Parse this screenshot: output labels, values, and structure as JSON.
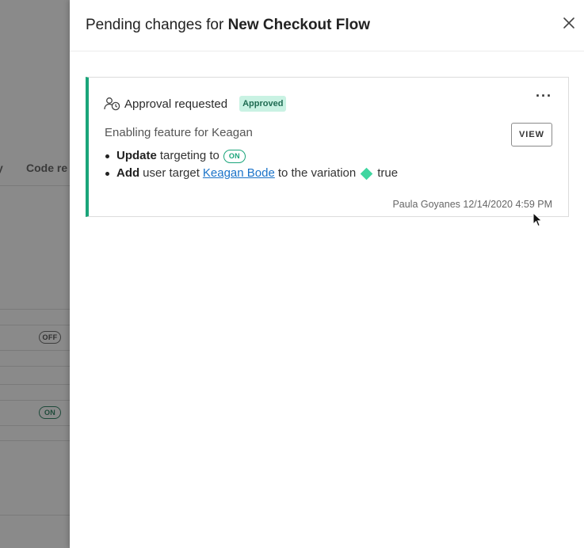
{
  "background": {
    "column_headers": [
      "y",
      "Code re"
    ],
    "row_toggles": [
      "OFF",
      "ON"
    ]
  },
  "panel": {
    "title_prefix": "Pending changes for",
    "title_flag": "New Checkout Flow"
  },
  "card": {
    "status_label": "Approval requested",
    "badge": "Approved",
    "more_label": "···",
    "view_button": "VIEW",
    "description": "Enabling feature for Keagan",
    "changes": [
      {
        "action": "Update",
        "text": "targeting to",
        "pill": "ON"
      },
      {
        "action": "Add",
        "text": "user target",
        "link": "Keagan Bode",
        "suffix": "to the variation",
        "variation": "true"
      }
    ],
    "author": "Paula Goyanes",
    "timestamp": "12/14/2020 4:59 PM"
  },
  "colors": {
    "accent_green": "#1aa57a",
    "badge_bg": "#c9f2e3",
    "variation_diamond": "#3fd6a0",
    "link": "#1a73c9"
  }
}
